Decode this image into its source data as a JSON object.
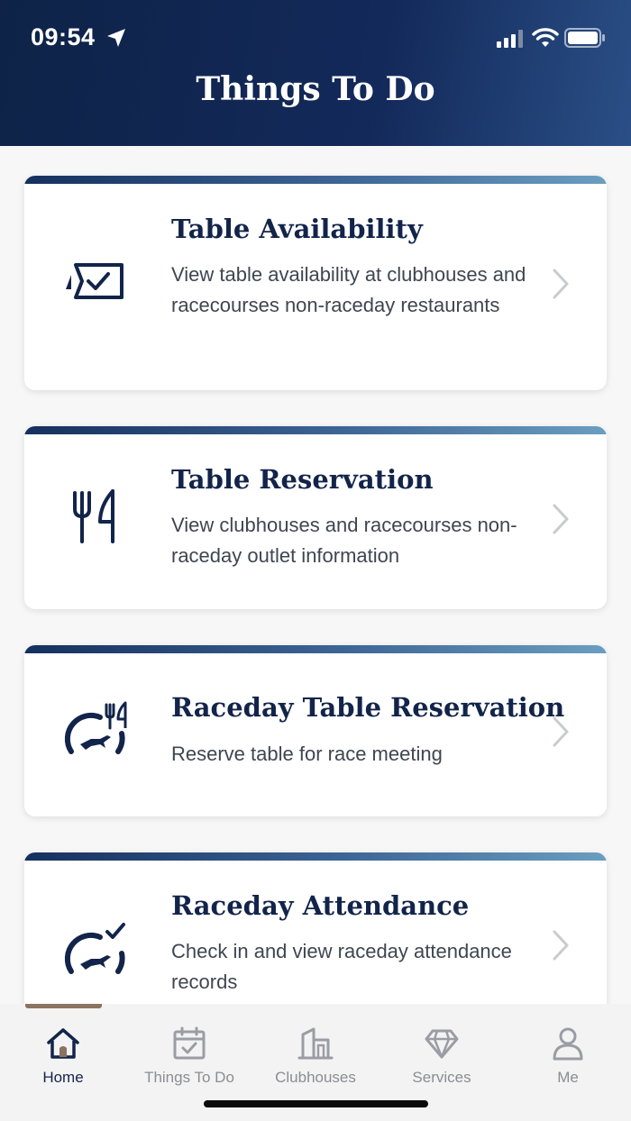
{
  "status_bar": {
    "time": "09:54"
  },
  "header": {
    "title": "Things To Do"
  },
  "cards": [
    {
      "title": "Table Availability",
      "description": "View table availability at clubhouses and racecourses non-raceday restaurants",
      "icon": "table-check-icon"
    },
    {
      "title": "Table Reservation",
      "description": "View clubhouses and racecourses non-raceday outlet information",
      "icon": "fork-knife-icon"
    },
    {
      "title": "Raceday Table Reservation",
      "description": "Reserve table for race meeting",
      "icon": "raceday-dining-icon"
    },
    {
      "title": "Raceday Attendance",
      "description": "Check in and view raceday attendance records",
      "icon": "raceday-check-icon"
    }
  ],
  "tabbar": {
    "items": [
      {
        "label": "Home",
        "icon": "home-icon",
        "active": true
      },
      {
        "label": "Things To Do",
        "icon": "calendar-check-icon",
        "active": false
      },
      {
        "label": "Clubhouses",
        "icon": "building-icon",
        "active": false
      },
      {
        "label": "Services",
        "icon": "diamond-icon",
        "active": false
      },
      {
        "label": "Me",
        "icon": "person-icon",
        "active": false
      }
    ]
  },
  "colors": {
    "navy": "#12244a",
    "accent_brown": "#8a735f",
    "muted": "#8a8d93"
  }
}
